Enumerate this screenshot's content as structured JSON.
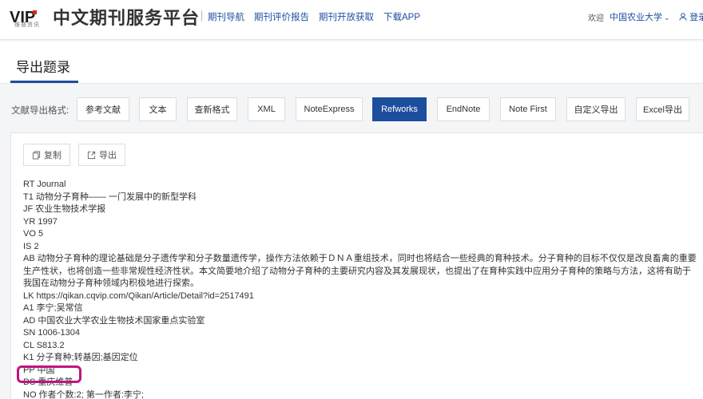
{
  "header": {
    "logo_text": "VIP",
    "logo_sub": "维普资讯",
    "brand": "中文期刊服务平台",
    "nav": [
      "期刊导航",
      "期刊评价报告",
      "期刊开放获取",
      "下载APP"
    ],
    "welcome": "欢迎",
    "org": "中国农业大学",
    "login": "登录"
  },
  "page": {
    "title": "导出题录"
  },
  "formats": {
    "label": "文献导出格式:",
    "items": [
      "参考文献",
      "文本",
      "查新格式",
      "XML",
      "NoteExpress",
      "Refworks",
      "EndNote",
      "Note First",
      "自定义导出",
      "Excel导出"
    ],
    "active_index": 5
  },
  "toolbar": {
    "copy": "复制",
    "export": "导出"
  },
  "record": [
    "RT Journal",
    "T1 动物分子育种—— 一门发展中的新型学科",
    "JF 农业生物技术学报",
    "YR 1997",
    "VO 5",
    "IS 2",
    "AB 动物分子育种的理论基础是分子遗传学和分子数量遗传学，操作方法依赖于ＤＮＡ重组技术，同时也将结合一些经典的育种技术。分子育种的目标不仅仅是改良畜禽的重要生产性状，也将创造一些非常规性经济性状。本文简要地介绍了动物分子育种的主要研究内容及其发展现状，也提出了在育种实践中应用分子育种的策略与方法，这将有助于我国在动物分子育种领域内积极地进行探索。",
    "LK https://qikan.cqvip.com/Qikan/Article/Detail?id=2517491",
    "A1 李宁;吴常信",
    "AD 中国农业大学农业生物技术国家重点实验室",
    "SN 1006-1304",
    "CL S813.2",
    "K1 分子育种;转基因;基因定位",
    "PP 中国",
    "DS 重庆维普",
    "NO 作者个数:2; 第一作者:李宁;"
  ],
  "colors": {
    "accent": "#1d4e9e",
    "highlight": "#c0157e"
  }
}
